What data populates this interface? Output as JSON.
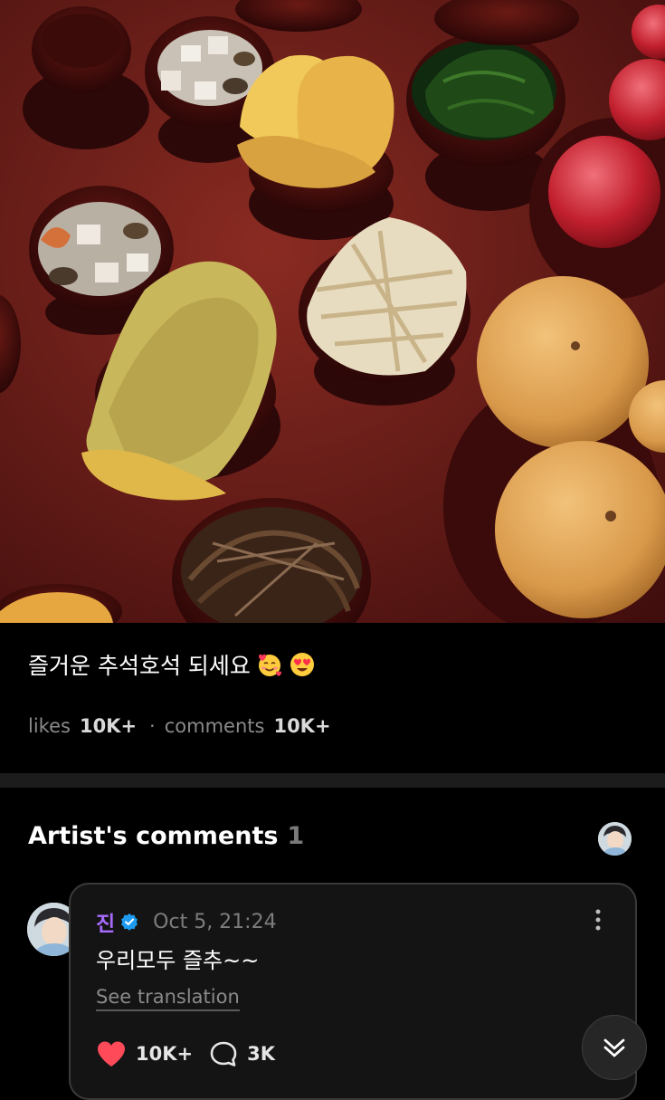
{
  "post": {
    "caption": "즐거운 추석호석 되세요",
    "emojis": [
      "smiling-face-with-hearts",
      "heart-eyes"
    ],
    "likes_label": "likes",
    "likes_value": "10K+",
    "separator": "·",
    "comments_label": "comments",
    "comments_value": "10K+"
  },
  "artist_comments": {
    "title": "Artist's comments",
    "count": "1"
  },
  "comment": {
    "author": "진",
    "timestamp": "Oct 5, 21:24",
    "text": "우리모두 즐추~~",
    "see_translation": "See translation",
    "like_count": "10K+",
    "reply_count": "3K"
  },
  "colors": {
    "author_name": "#a86bff",
    "verified_badge": "#1e9bf0",
    "heart": "#ff4a5a"
  }
}
